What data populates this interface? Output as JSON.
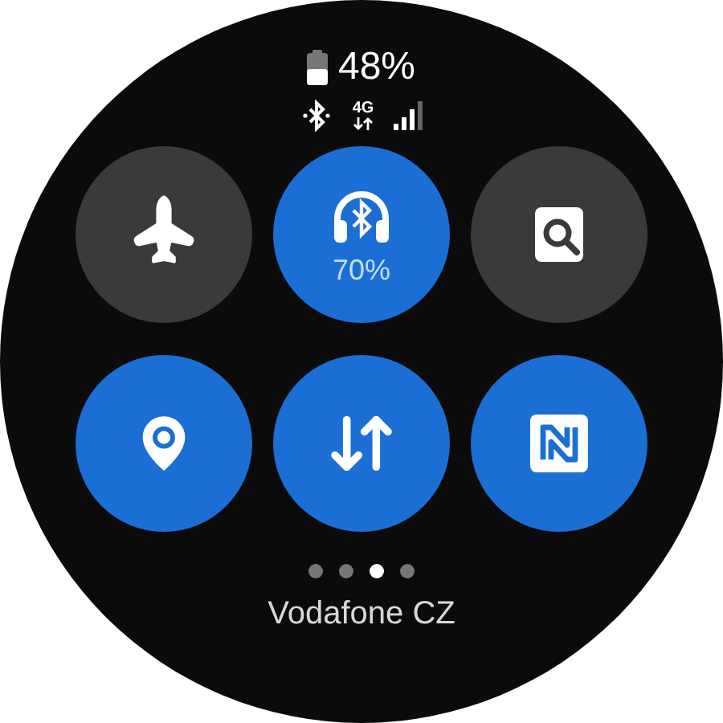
{
  "status": {
    "battery": "48%",
    "network": "4G"
  },
  "tiles": [
    {
      "kind": "airplane",
      "on": false
    },
    {
      "kind": "headphones",
      "on": true,
      "label": "70%"
    },
    {
      "kind": "finder",
      "on": false
    },
    {
      "kind": "location",
      "on": true
    },
    {
      "kind": "data",
      "on": true
    },
    {
      "kind": "nfc",
      "on": true
    }
  ],
  "pages": [
    {
      "selected": false
    },
    {
      "selected": false
    },
    {
      "selected": true
    },
    {
      "selected": false
    }
  ],
  "carrier": "Vodafone CZ"
}
